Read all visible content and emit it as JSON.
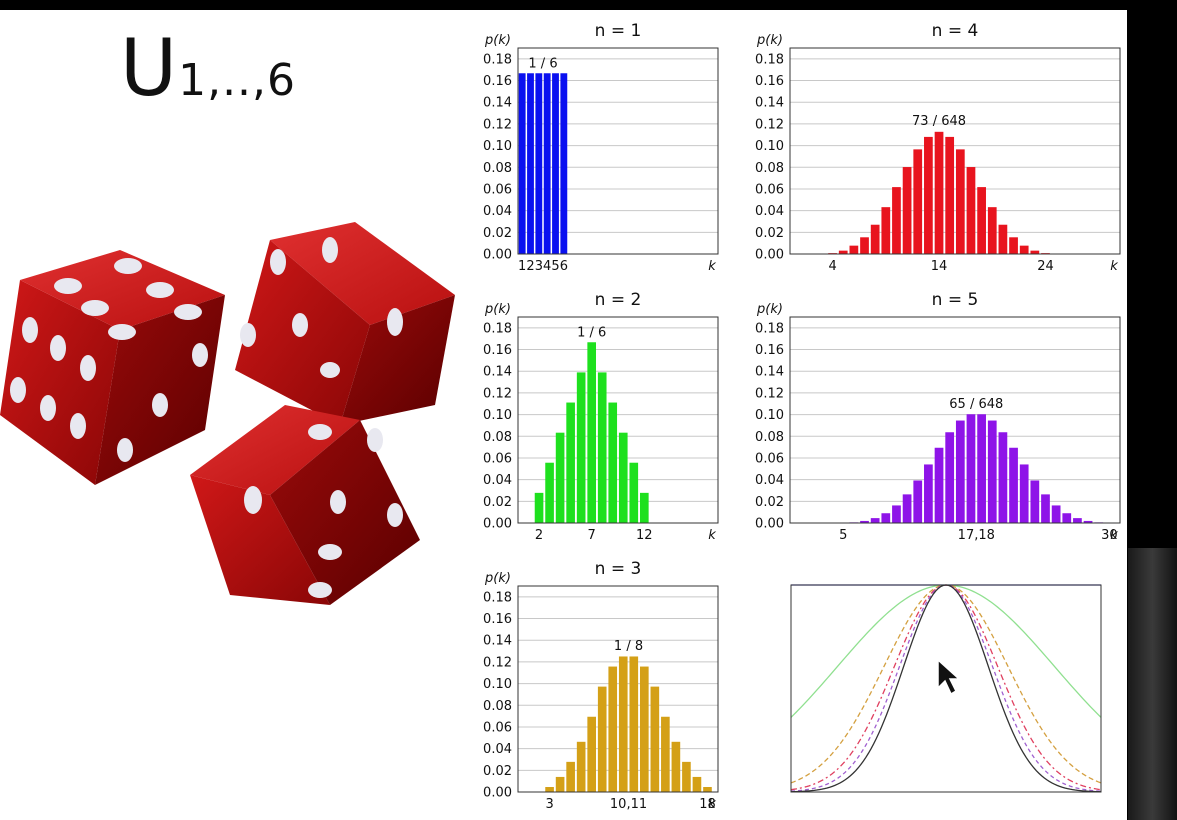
{
  "slide": {
    "title": "U",
    "title_sub": "1,..,6"
  },
  "chart_data": [
    {
      "type": "bar",
      "title": "n = 1",
      "ylabel": "p(k)",
      "xlabel": "k",
      "color": "#0a10f0",
      "x": [
        1,
        2,
        3,
        4,
        5,
        6
      ],
      "values": [
        0.1667,
        0.1667,
        0.1667,
        0.1667,
        0.1667,
        0.1667
      ],
      "xticks": [
        "1",
        "2",
        "3",
        "4",
        "5",
        "6"
      ],
      "xlim": [
        0.5,
        24.5
      ],
      "ylim": [
        0,
        0.19
      ],
      "yticks": [
        "0.00",
        "0.02",
        "0.04",
        "0.06",
        "0.08",
        "0.10",
        "0.12",
        "0.14",
        "0.16",
        "0.18"
      ],
      "annotation": "1 / 6",
      "annotation_x": 3.5,
      "annotation_y": 0.172,
      "grid": "horizontal"
    },
    {
      "type": "bar",
      "title": "n = 2",
      "ylabel": "p(k)",
      "xlabel": "k",
      "color": "#1ee01e",
      "x": [
        2,
        3,
        4,
        5,
        6,
        7,
        8,
        9,
        10,
        11,
        12
      ],
      "values": [
        0.0278,
        0.0556,
        0.0833,
        0.1111,
        0.1389,
        0.1667,
        0.1389,
        0.1111,
        0.0833,
        0.0556,
        0.0278
      ],
      "xticks": [
        "2",
        "7",
        "12"
      ],
      "xtick_values": [
        2,
        7,
        12
      ],
      "xlim": [
        0,
        19
      ],
      "ylim": [
        0,
        0.19
      ],
      "yticks": [
        "0.00",
        "0.02",
        "0.04",
        "0.06",
        "0.08",
        "0.10",
        "0.12",
        "0.14",
        "0.16",
        "0.18"
      ],
      "annotation": "1 / 6",
      "annotation_x": 7,
      "annotation_y": 0.172,
      "grid": "horizontal"
    },
    {
      "type": "bar",
      "title": "n = 3",
      "ylabel": "p(k)",
      "xlabel": "k",
      "color": "#d4a017",
      "x": [
        3,
        4,
        5,
        6,
        7,
        8,
        9,
        10,
        11,
        12,
        13,
        14,
        15,
        16,
        17,
        18
      ],
      "values": [
        0.0046,
        0.0139,
        0.0278,
        0.0463,
        0.0694,
        0.0972,
        0.1157,
        0.125,
        0.125,
        0.1157,
        0.0972,
        0.0694,
        0.0463,
        0.0278,
        0.0139,
        0.0046
      ],
      "xticks": [
        "3",
        "10,11",
        "18"
      ],
      "xtick_values": [
        3,
        10.5,
        18
      ],
      "xlim": [
        0,
        19
      ],
      "ylim": [
        0,
        0.19
      ],
      "yticks": [
        "0.00",
        "0.02",
        "0.04",
        "0.06",
        "0.08",
        "0.10",
        "0.12",
        "0.14",
        "0.16",
        "0.18"
      ],
      "annotation": "1 / 8",
      "annotation_x": 10.5,
      "annotation_y": 0.131,
      "grid": "horizontal"
    },
    {
      "type": "bar",
      "title": "n = 4",
      "xlabel": "k",
      "ylabel": "p(k)",
      "color": "#e8141e",
      "x": [
        4,
        5,
        6,
        7,
        8,
        9,
        10,
        11,
        12,
        13,
        14,
        15,
        16,
        17,
        18,
        19,
        20,
        21,
        22,
        23,
        24
      ],
      "values": [
        0.0008,
        0.0031,
        0.0077,
        0.0154,
        0.027,
        0.0432,
        0.0617,
        0.0802,
        0.0965,
        0.108,
        0.1127,
        0.108,
        0.0965,
        0.0802,
        0.0617,
        0.0432,
        0.027,
        0.0154,
        0.0077,
        0.0031,
        0.0008
      ],
      "xticks": [
        "4",
        "14",
        "24"
      ],
      "xtick_values": [
        4,
        14,
        24
      ],
      "xlim": [
        0,
        31
      ],
      "ylim": [
        0,
        0.19
      ],
      "yticks": [
        "0.00",
        "0.02",
        "0.04",
        "0.06",
        "0.08",
        "0.10",
        "0.12",
        "0.14",
        "0.16",
        "0.18"
      ],
      "annotation": "73 / 648",
      "annotation_x": 14,
      "annotation_y": 0.119,
      "grid": "horizontal"
    },
    {
      "type": "bar",
      "title": "n = 5",
      "xlabel": "k",
      "ylabel": "p(k)",
      "color": "#8e14e8",
      "x": [
        5,
        6,
        7,
        8,
        9,
        10,
        11,
        12,
        13,
        14,
        15,
        16,
        17,
        18,
        19,
        20,
        21,
        22,
        23,
        24,
        25,
        26,
        27,
        28,
        29,
        30
      ],
      "values": [
        0.0001,
        0.0006,
        0.0019,
        0.0045,
        0.009,
        0.0162,
        0.0264,
        0.0392,
        0.054,
        0.0694,
        0.0837,
        0.0945,
        0.1003,
        0.1003,
        0.0945,
        0.0837,
        0.0694,
        0.054,
        0.0392,
        0.0264,
        0.0162,
        0.009,
        0.0045,
        0.0019,
        0.0006,
        0.0001
      ],
      "xticks": [
        "5",
        "17,18",
        "30"
      ],
      "xtick_values": [
        5,
        17.5,
        30
      ],
      "xlim": [
        0,
        31
      ],
      "ylim": [
        0,
        0.19
      ],
      "yticks": [
        "0.00",
        "0.02",
        "0.04",
        "0.06",
        "0.08",
        "0.10",
        "0.12",
        "0.14",
        "0.16",
        "0.18"
      ],
      "annotation": "65 / 648",
      "annotation_x": 17.5,
      "annotation_y": 0.106,
      "grid": "horizontal"
    },
    {
      "type": "line",
      "xlim": [
        -3,
        3
      ],
      "ylim": [
        0,
        1
      ],
      "series": [
        {
          "color": "#4040d0",
          "dash": "",
          "sigma": 0
        },
        {
          "color": "#90e090",
          "dash": "",
          "sigma": 2.1
        },
        {
          "color": "#d4a040",
          "dash": "5,3",
          "sigma": 1.2
        },
        {
          "color": "#e04060",
          "dash": "6,3,2,3",
          "sigma": 1.0
        },
        {
          "color": "#a060d0",
          "dash": "4,3",
          "sigma": 0.9
        },
        {
          "color": "#333333",
          "dash": "",
          "sigma": 0.82
        }
      ]
    }
  ]
}
